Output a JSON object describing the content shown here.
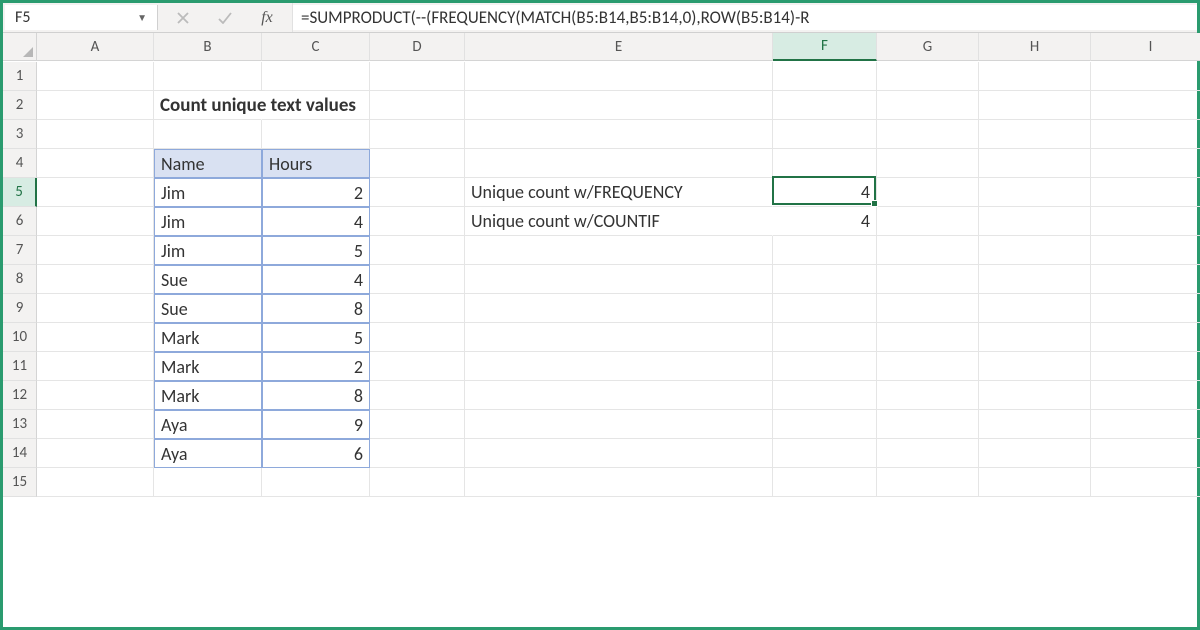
{
  "name_box": "F5",
  "formula": "=SUMPRODUCT(--(FREQUENCY(MATCH(B5:B14,B5:B14,0),ROW(B5:B14)-R",
  "columns": [
    "A",
    "B",
    "C",
    "D",
    "E",
    "F",
    "G",
    "H",
    "I"
  ],
  "rows_visible": 15,
  "active_col": "F",
  "active_row": 5,
  "title": "Count unique text values",
  "table": {
    "headers": [
      "Name",
      "Hours"
    ],
    "rows": [
      {
        "name": "Jim",
        "hours": "2"
      },
      {
        "name": "Jim",
        "hours": "4"
      },
      {
        "name": "Jim",
        "hours": "5"
      },
      {
        "name": "Sue",
        "hours": "4"
      },
      {
        "name": "Sue",
        "hours": "8"
      },
      {
        "name": "Mark",
        "hours": "5"
      },
      {
        "name": "Mark",
        "hours": "2"
      },
      {
        "name": "Mark",
        "hours": "8"
      },
      {
        "name": "Aya",
        "hours": "9"
      },
      {
        "name": "Aya",
        "hours": "6"
      }
    ]
  },
  "labels": {
    "e5": "Unique count w/FREQUENCY",
    "e6": "Unique count w/COUNTIF"
  },
  "values": {
    "f5": "4",
    "f6": "4"
  },
  "chart_data": {
    "type": "table",
    "categories": [
      "Name",
      "Hours"
    ],
    "rows": [
      [
        "Jim",
        2
      ],
      [
        "Jim",
        4
      ],
      [
        "Jim",
        5
      ],
      [
        "Sue",
        4
      ],
      [
        "Sue",
        8
      ],
      [
        "Mark",
        5
      ],
      [
        "Mark",
        2
      ],
      [
        "Mark",
        8
      ],
      [
        "Aya",
        9
      ],
      [
        "Aya",
        6
      ]
    ],
    "title": "Count unique text values",
    "summary": [
      {
        "label": "Unique count w/FREQUENCY",
        "value": 4
      },
      {
        "label": "Unique count w/COUNTIF",
        "value": 4
      }
    ]
  }
}
